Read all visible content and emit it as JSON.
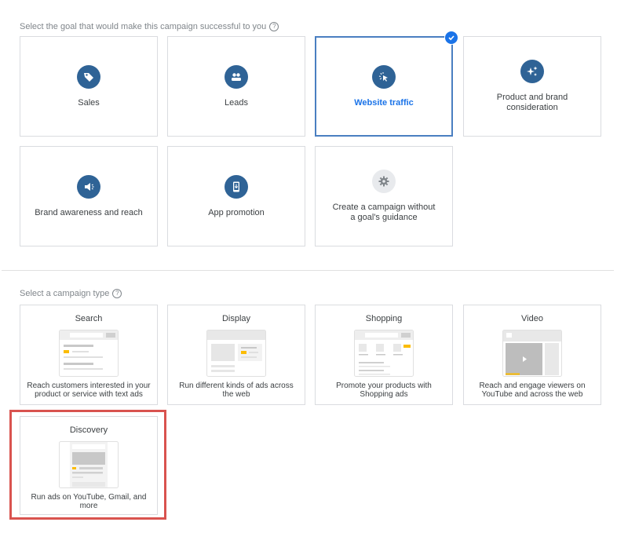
{
  "goal_section": {
    "label": "Select the goal that would make this campaign successful to you",
    "help_icon": "?",
    "goals": [
      {
        "label": "Sales",
        "icon": "tag-icon",
        "selected": false
      },
      {
        "label": "Leads",
        "icon": "people-icon",
        "selected": false
      },
      {
        "label": "Website traffic",
        "icon": "cursor-click-icon",
        "selected": true
      },
      {
        "label": "Product and brand consideration",
        "icon": "sparkle-icon",
        "selected": false
      },
      {
        "label": "Brand awareness and reach",
        "icon": "megaphone-icon",
        "selected": false
      },
      {
        "label": "App promotion",
        "icon": "phone-download-icon",
        "selected": false
      },
      {
        "label": "Create a campaign without a goal's guidance",
        "icon": "gear-icon",
        "selected": false
      }
    ]
  },
  "campaign_section": {
    "label": "Select a campaign type",
    "help_icon": "?",
    "types": [
      {
        "title": "Search",
        "description": "Reach customers interested in your product or service with text ads"
      },
      {
        "title": "Display",
        "description": "Run different kinds of ads across the web"
      },
      {
        "title": "Shopping",
        "description": "Promote your products with Shopping ads"
      },
      {
        "title": "Video",
        "description": "Reach and engage viewers on YouTube and across the web"
      },
      {
        "title": "Discovery",
        "description": "Run ads on YouTube, Gmail, and more",
        "highlighted": true
      }
    ]
  },
  "colors": {
    "accent": "#1a73e8",
    "icon_bg": "#2f6396",
    "highlight": "#d9534f",
    "ad_yellow": "#fbbc04"
  }
}
